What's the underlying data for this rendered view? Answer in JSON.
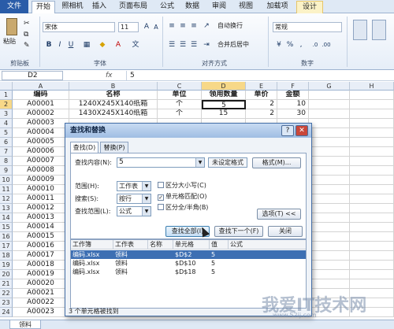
{
  "ribbon_tabs": [
    "文件",
    "开始",
    "照相机",
    "插入",
    "页面布局",
    "公式",
    "数据",
    "审阅",
    "视图",
    "加载项",
    "设计"
  ],
  "ribbon": {
    "paste_label": "粘贴",
    "clipboard_label": "剪贴板",
    "font_name": "宋体",
    "font_size": "11",
    "font_group_label": "字体",
    "wrap_label": "自动换行",
    "merge_label": "合并后居中",
    "align_group_label": "对齐方式",
    "number_format": "常规",
    "number_group_label": "数字"
  },
  "formula_bar": {
    "name_box": "D2",
    "fx": "fx",
    "value": "5"
  },
  "columns": [
    "A",
    "B",
    "C",
    "D",
    "E",
    "F",
    "G",
    "H"
  ],
  "header_row": [
    "编码",
    "名称",
    "单位",
    "领用数量",
    "单价",
    "金额"
  ],
  "rows": [
    [
      "A00001",
      "1240X245X140纸箱",
      "个",
      "5",
      "2",
      "10"
    ],
    [
      "A00002",
      "1430X245X140纸箱",
      "个",
      "15",
      "2",
      "30"
    ],
    [
      "A00003",
      "",
      "",
      "",
      "",
      ""
    ],
    [
      "A00004",
      "",
      "",
      "",
      "",
      ""
    ],
    [
      "A00005",
      "",
      "",
      "",
      "",
      ""
    ],
    [
      "A00006",
      "",
      "",
      "",
      "",
      ""
    ],
    [
      "A00007",
      "",
      "",
      "",
      "",
      ""
    ],
    [
      "A00008",
      "",
      "",
      "",
      "",
      ""
    ],
    [
      "A00009",
      "",
      "",
      "",
      "",
      ""
    ],
    [
      "A00010",
      "",
      "",
      "",
      "",
      ""
    ],
    [
      "A00011",
      "",
      "",
      "",
      "",
      ""
    ],
    [
      "A00012",
      "",
      "",
      "",
      "",
      ""
    ],
    [
      "A00013",
      "",
      "",
      "",
      "",
      ""
    ],
    [
      "A00014",
      "",
      "",
      "",
      "",
      ""
    ],
    [
      "A00015",
      "",
      "",
      "",
      "",
      ""
    ],
    [
      "A00016",
      "",
      "",
      "",
      "",
      ""
    ],
    [
      "A00017",
      "",
      "",
      "",
      "",
      ""
    ],
    [
      "A00018",
      "",
      "",
      "",
      "",
      ""
    ],
    [
      "A00019",
      "",
      "",
      "",
      "",
      ""
    ],
    [
      "A00020",
      "",
      "",
      "",
      "",
      ""
    ],
    [
      "A00021",
      "",
      "",
      "",
      "",
      ""
    ],
    [
      "A00022",
      "",
      "",
      "",
      "",
      ""
    ],
    [
      "A00023",
      "",
      "",
      "",
      "",
      ""
    ]
  ],
  "sheet_tab": "领料",
  "dialog": {
    "title": "查找和替换",
    "tab_find": "查找(D)",
    "tab_replace": "替换(P)",
    "find_label": "查找内容(N):",
    "find_value": "5",
    "format_status": "未设定格式",
    "format_button": "格式(M)...",
    "scope_label": "范围(H):",
    "scope_value": "工作表",
    "search_label": "搜索(S):",
    "search_value": "按行",
    "lookin_label": "查找范围(L):",
    "lookin_value": "公式",
    "match_case": "区分大小写(C)",
    "match_cell": "单元格匹配(O)",
    "match_width": "区分全/半角(B)",
    "options_button": "选项(T) <<",
    "find_all": "查找全部(I)",
    "find_next": "查找下一个(F)",
    "close": "关闭",
    "result_headers": [
      "工作簿",
      "工作表",
      "名称",
      "单元格",
      "值",
      "公式"
    ],
    "results": [
      [
        "编码.xlsx",
        "领料",
        "",
        "$D$2",
        "5",
        ""
      ],
      [
        "编码.xlsx",
        "领料",
        "",
        "$D$10",
        "5",
        ""
      ],
      [
        "编码.xlsx",
        "领料",
        "",
        "$D$18",
        "5",
        ""
      ]
    ],
    "status": "3 个单元格被找到"
  },
  "watermark": "我爱IT技术网",
  "watermark_sub": "www.52ij.com"
}
